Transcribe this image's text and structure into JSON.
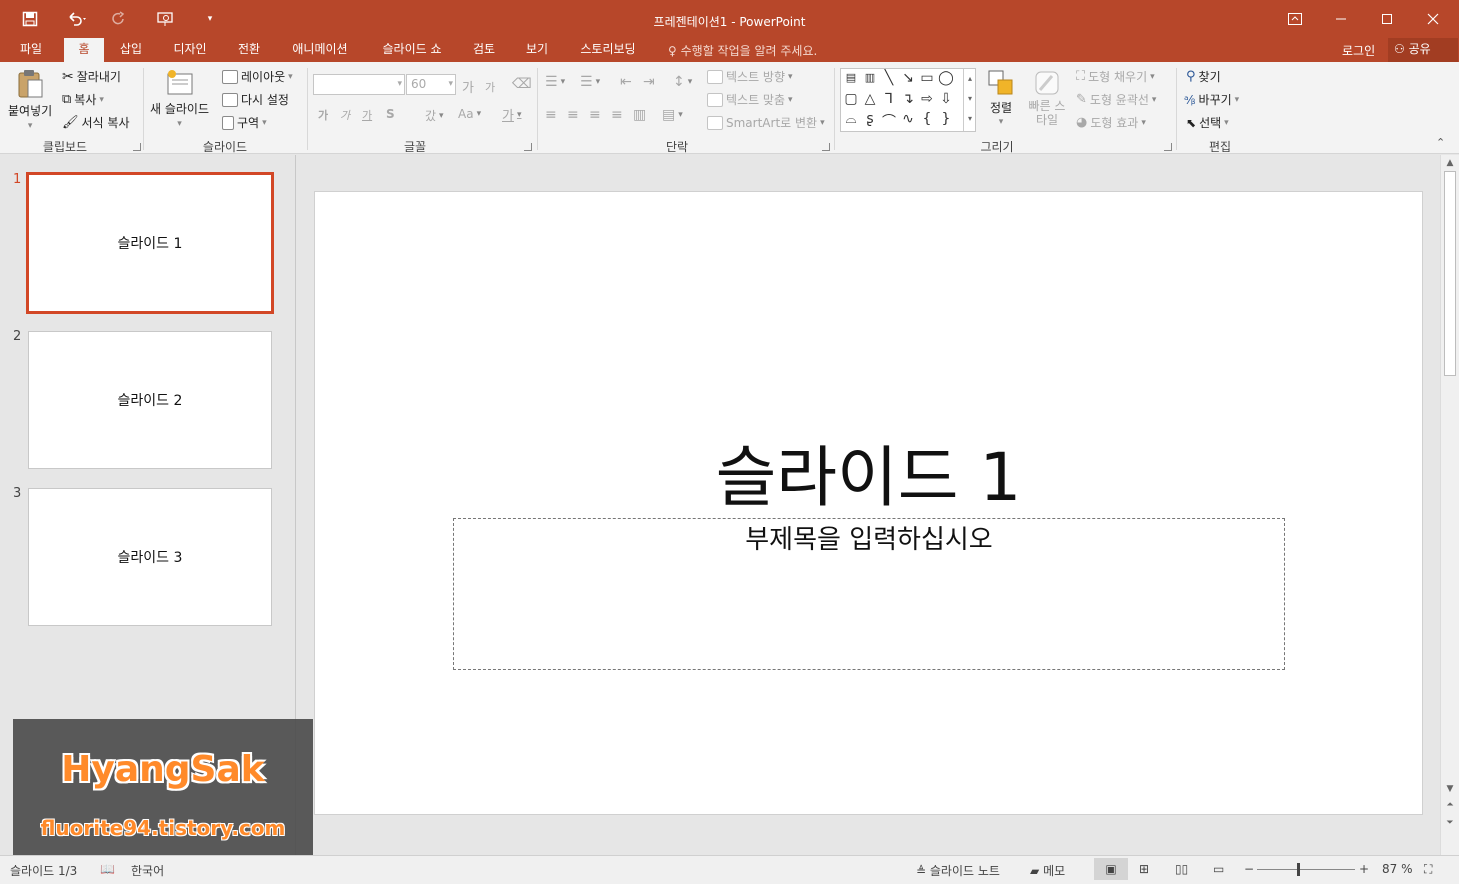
{
  "titlebar": {
    "title": "프레젠테이션1 - PowerPoint",
    "color": "#b7472a"
  },
  "quick_access": [
    "save-icon",
    "undo-icon",
    "redo-icon",
    "start-from-beginning-icon",
    "customize-icon"
  ],
  "tabs": [
    {
      "label": "파일",
      "active": false
    },
    {
      "label": "홈",
      "active": true
    },
    {
      "label": "삽입",
      "active": false
    },
    {
      "label": "디자인",
      "active": false
    },
    {
      "label": "전환",
      "active": false
    },
    {
      "label": "애니메이션",
      "active": false
    },
    {
      "label": "슬라이드 쇼",
      "active": false
    },
    {
      "label": "검토",
      "active": false
    },
    {
      "label": "보기",
      "active": false
    },
    {
      "label": "스토리보딩",
      "active": false
    }
  ],
  "tell_me": "수행할 작업을 알려 주세요.",
  "account": {
    "login": "로그인",
    "share": "공유"
  },
  "ribbon": {
    "clipboard": {
      "label": "클립보드",
      "paste": "붙여넣기",
      "cut": "잘라내기",
      "copy": "복사",
      "format_painter": "서식 복사"
    },
    "slides": {
      "label": "슬라이드",
      "new_slide": "새 슬라이드",
      "layout": "레이아웃",
      "reset": "다시 설정",
      "section": "구역"
    },
    "font": {
      "label": "글꼴",
      "font_size": "60",
      "increase": "가",
      "decrease": "가",
      "bold": "가",
      "italic": "가",
      "underline": "가",
      "shadow": "S",
      "spacing": "갔",
      "case": "Aa",
      "color": "가"
    },
    "paragraph": {
      "label": "단락",
      "text_direction": "텍스트 방향",
      "align_text": "텍스트 맞춤",
      "smartart": "SmartArt로 변환"
    },
    "drawing": {
      "label": "그리기",
      "arrange": "정렬",
      "quick_styles": "빠른 스타일",
      "shape_fill": "도형 채우기",
      "shape_outline": "도형 윤곽선",
      "shape_effects": "도형 효과"
    },
    "editing": {
      "label": "편집",
      "find": "찾기",
      "replace": "바꾸기",
      "select": "선택"
    }
  },
  "thumbnails": [
    {
      "num": "1",
      "label": "슬라이드 1",
      "selected": true
    },
    {
      "num": "2",
      "label": "슬라이드 2",
      "selected": false
    },
    {
      "num": "3",
      "label": "슬라이드 3",
      "selected": false
    }
  ],
  "slide": {
    "title": "슬라이드 1",
    "subtitle": "부제목을 입력하십시오"
  },
  "watermark": {
    "line1": "HyangSak",
    "line2": "fluorite94.tistory.com"
  },
  "statusbar": {
    "slide_count": "슬라이드 1/3",
    "language": "한국어",
    "notes": "슬라이드 노트",
    "comments": "메모",
    "zoom": "87 %",
    "zoom_fraction": 0.42
  }
}
